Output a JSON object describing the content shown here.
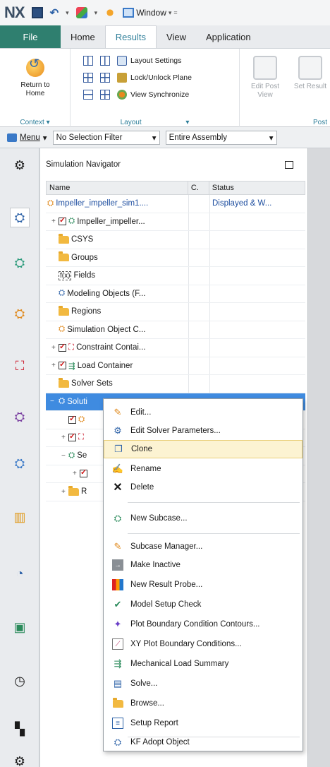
{
  "app": {
    "logo": "NX",
    "window_menu": "Window"
  },
  "ribbon_tabs": [
    "File",
    "Home",
    "Results",
    "View",
    "Application"
  ],
  "active_tab": "Results",
  "ribbon": {
    "context": {
      "return_home": "Return to Home",
      "group_label": "Context"
    },
    "layout": {
      "layout_settings": "Layout Settings",
      "lock_unlock_plane": "Lock/Unlock Plane",
      "view_synchronize": "View Synchronize",
      "group_label": "Layout"
    },
    "post": {
      "edit_post_view": "Edit Post View",
      "set_result": "Set Result",
      "group_label": "Post"
    }
  },
  "selection_bar": {
    "menu": "Menu",
    "filter": "No Selection Filter",
    "scope": "Entire Assembly"
  },
  "navigator": {
    "title": "Simulation Navigator",
    "columns": [
      "Name",
      "C.",
      "Status"
    ],
    "rows": [
      {
        "name": "Impeller_impeller_sim1....",
        "status": "Displayed & W..."
      },
      {
        "name": "Impeller_impeller...",
        "status": ""
      },
      {
        "name": "CSYS",
        "status": ""
      },
      {
        "name": "Groups",
        "status": ""
      },
      {
        "name": "Fields",
        "status": ""
      },
      {
        "name": "Modeling Objects (F...",
        "status": ""
      },
      {
        "name": "Regions",
        "status": ""
      },
      {
        "name": "Simulation Object C...",
        "status": ""
      },
      {
        "name": "Constraint Contai...",
        "status": ""
      },
      {
        "name": "Load Container",
        "status": ""
      },
      {
        "name": "Solver Sets",
        "status": ""
      },
      {
        "name": "Soluti",
        "status": ""
      },
      {
        "name": "",
        "status": ""
      },
      {
        "name": "",
        "status": ""
      },
      {
        "name": "Se",
        "status": ""
      },
      {
        "name": "",
        "status": ""
      },
      {
        "name": "R",
        "status": ""
      }
    ]
  },
  "context_menu": [
    {
      "label": "Edit...",
      "icon": "edit-icon"
    },
    {
      "label": "Edit Solver Parameters...",
      "icon": "solver-parameters-icon"
    },
    {
      "label": "Clone",
      "icon": "clone-icon",
      "highlighted": true
    },
    {
      "label": "Rename",
      "icon": "rename-icon"
    },
    {
      "label": "Delete",
      "icon": "delete-icon"
    },
    {
      "label": "New Subcase...",
      "icon": "new-subcase-icon"
    },
    {
      "label": "Subcase Manager...",
      "icon": "subcase-manager-icon"
    },
    {
      "label": "Make Inactive",
      "icon": "make-inactive-icon"
    },
    {
      "label": "New Result Probe...",
      "icon": "result-probe-icon"
    },
    {
      "label": "Model Setup Check",
      "icon": "model-check-icon"
    },
    {
      "label": "Plot Boundary Condition Contours...",
      "icon": "bc-contours-icon"
    },
    {
      "label": "XY Plot Boundary Conditions...",
      "icon": "xy-plot-icon"
    },
    {
      "label": "Mechanical Load Summary",
      "icon": "load-summary-icon"
    },
    {
      "label": "Solve...",
      "icon": "solve-icon"
    },
    {
      "label": "Browse...",
      "icon": "browse-icon"
    },
    {
      "label": "Setup Report",
      "icon": "setup-report-icon"
    },
    {
      "label": "KF Adopt Object",
      "icon": "kf-adopt-icon"
    }
  ],
  "colors": {
    "file_tab": "#2f7f6f",
    "selection": "#3f8be0",
    "menu_highlight": "#fcf3d2",
    "accent_text": "#2f7f9a"
  }
}
